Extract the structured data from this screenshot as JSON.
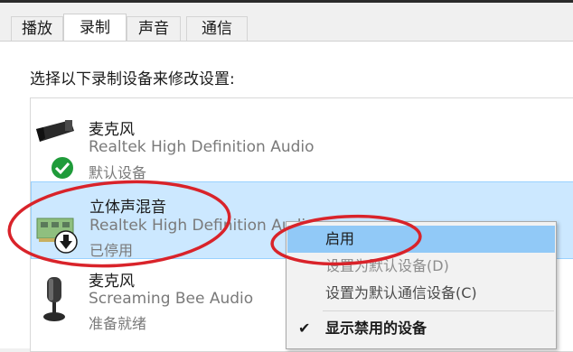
{
  "tabs": [
    {
      "label": "播放"
    },
    {
      "label": "录制"
    },
    {
      "label": "声音"
    },
    {
      "label": "通信"
    }
  ],
  "active_tab": "录制",
  "instruction": "选择以下录制设备来修改设置:",
  "devices": [
    {
      "name": "麦克风",
      "driver": "Realtek High Definition Audio",
      "status": "默认设备",
      "icon": "webcam-microphone-icon",
      "badge": "green-check-badge"
    },
    {
      "name": "立体声混音",
      "driver": "Realtek High Definition Audio",
      "status": "已停用",
      "icon": "sound-card-icon",
      "badge": "disabled-down-arrow-badge",
      "selected": true
    },
    {
      "name": "麦克风",
      "driver": "Screaming Bee Audio",
      "status": "准备就绪",
      "icon": "microphone-icon"
    }
  ],
  "context_menu": {
    "items": [
      {
        "label": "启用",
        "highlighted": true
      },
      {
        "label": "设置为默认设备(D)",
        "disabled": true
      },
      {
        "label": "设置为默认通信设备(C)",
        "disabled": false
      },
      {
        "label": "显示禁用的设备",
        "checked": true,
        "bold": true
      }
    ]
  },
  "colors": {
    "selection": "#cce8ff",
    "menu_highlight": "#91c9f7",
    "annotation_red": "#d9232a",
    "default_badge": "#1f9b3a"
  }
}
